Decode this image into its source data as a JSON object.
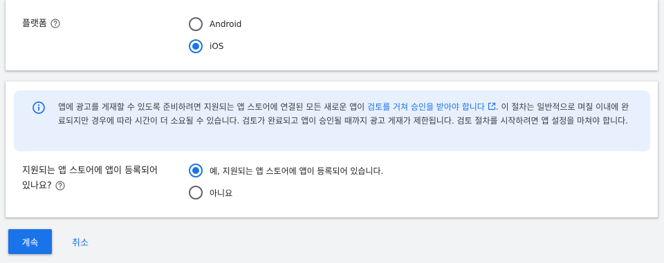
{
  "platform_section": {
    "label": "플랫폼",
    "options": [
      {
        "label": "Android",
        "selected": false
      },
      {
        "label": "iOS",
        "selected": true
      }
    ]
  },
  "info_banner": {
    "text_before": "앱에 광고를 게재할 수 있도록 준비하려면 지원되는 앱 스토어에 연결된 모든 새로운 앱이 ",
    "link_text": "검토를 거쳐 승인을 받아야 합니다",
    "text_after": ". 이 절차는 일반적으로 며칠 이내에 완료되지만 경우에 따라 시간이 더 소요될 수 있습니다. 검토가 완료되고 앱이 승인될 때까지 광고 게재가 제한됩니다. 검토 절차를 시작하려면 앱 설정을 마쳐야 합니다."
  },
  "store_question": {
    "label_line1": "지원되는 앱 스토어에 앱이 등록되어",
    "label_line2": "있나요?",
    "options": [
      {
        "label": "예, 지원되는 앱 스토어에 앱이 등록되어 있습니다.",
        "selected": true
      },
      {
        "label": "아니요",
        "selected": false
      }
    ]
  },
  "actions": {
    "continue_label": "계속",
    "cancel_label": "취소"
  },
  "colors": {
    "accent": "#1a73e8",
    "info_background": "#e8f0fe"
  },
  "icons": {
    "help": "help-circle-icon",
    "info": "info-icon",
    "external_link": "external-link-icon"
  }
}
